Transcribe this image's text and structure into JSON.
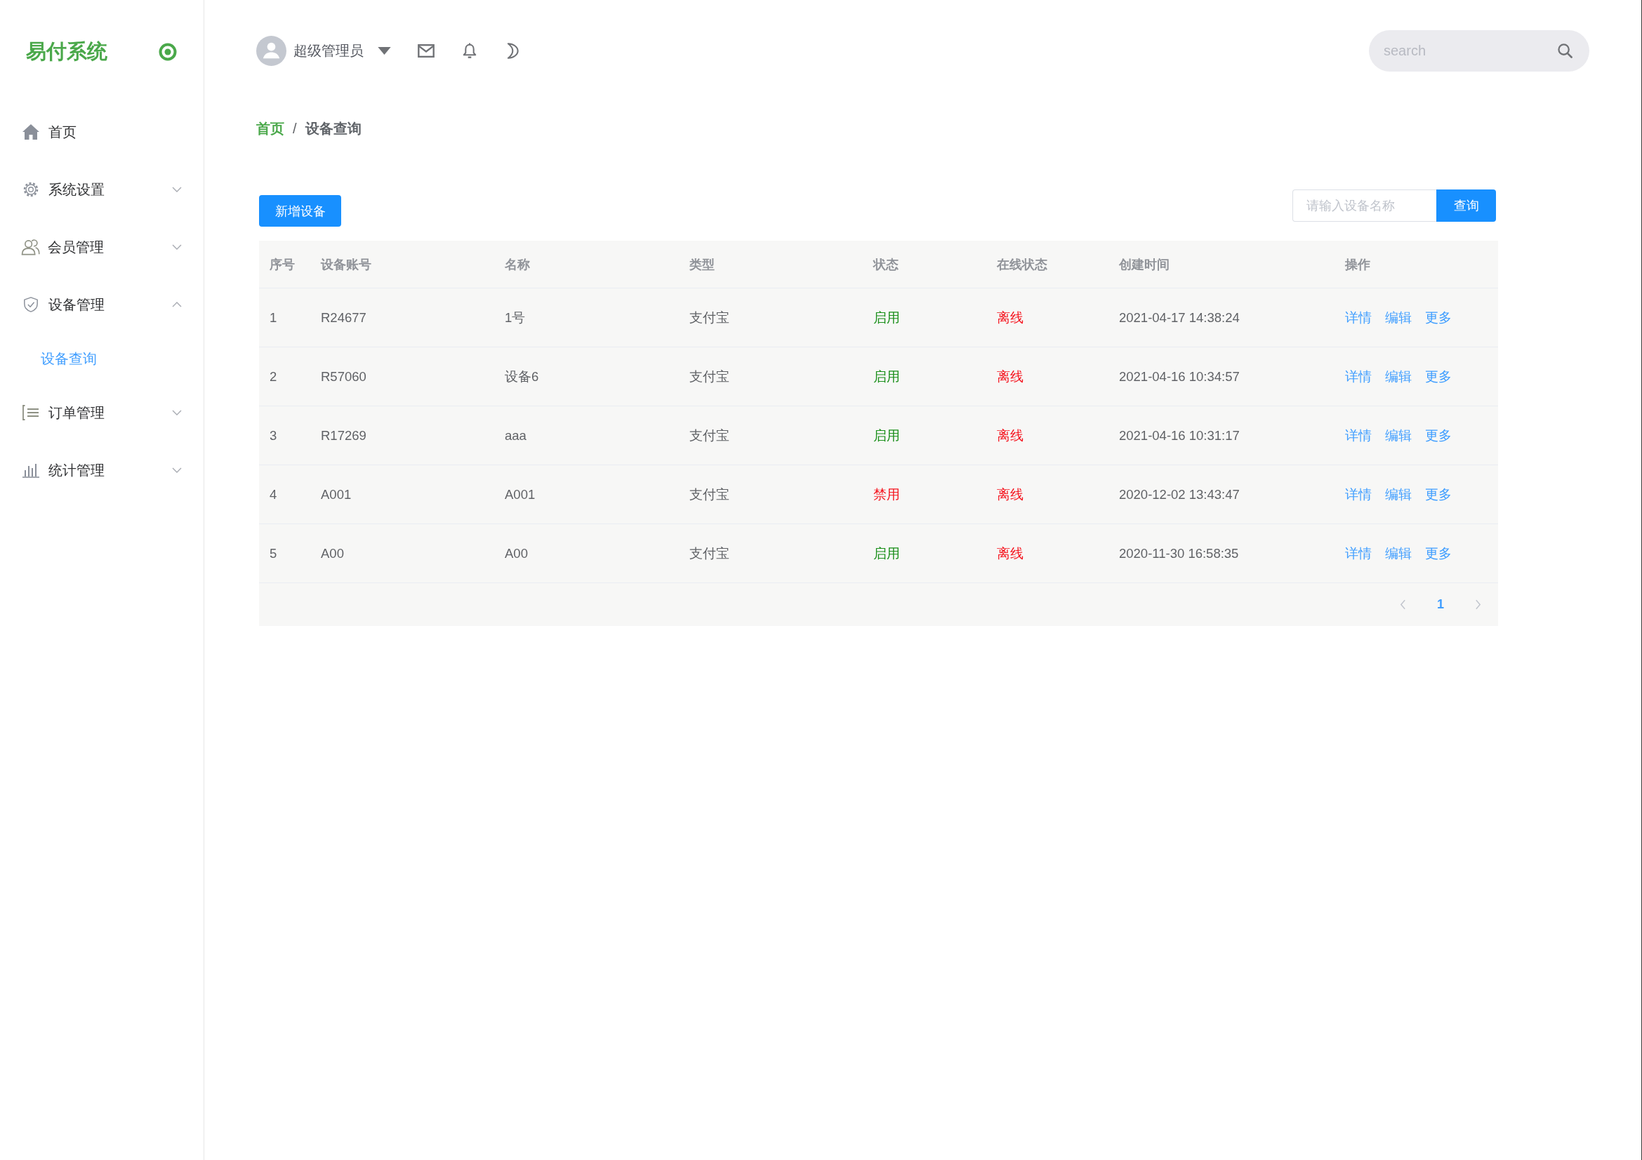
{
  "sidebar": {
    "brand": "易付系统",
    "nav": [
      {
        "label": "首页",
        "kind": "link",
        "selected": false
      },
      {
        "label": "系统设置",
        "kind": "group",
        "expanded": false,
        "selected": false
      },
      {
        "label": "会员管理",
        "kind": "group",
        "expanded": false,
        "selected": false
      },
      {
        "label": "设备管理",
        "kind": "group",
        "expanded": true,
        "selected": false,
        "children": [
          {
            "label": "设备查询",
            "selected": true
          }
        ]
      },
      {
        "label": "订单管理",
        "kind": "group",
        "expanded": false,
        "selected": false
      },
      {
        "label": "统计管理",
        "kind": "group",
        "expanded": false,
        "selected": false
      }
    ]
  },
  "header": {
    "user": {
      "name": "超级管理员"
    },
    "search": {
      "placeholder": "search"
    }
  },
  "breadcrumb": {
    "separator": "/",
    "items": [
      {
        "label": "首页",
        "current": false
      },
      {
        "label": "设备查询",
        "current": true
      }
    ]
  },
  "toolbar": {
    "add_button": "新增设备",
    "filter": {
      "placeholder": "请输入设备名称",
      "button": "查询"
    }
  },
  "table": {
    "columns": [
      "序号",
      "设备账号",
      "名称",
      "类型",
      "状态",
      "在线状态",
      "创建时间",
      "操作"
    ],
    "rows": [
      {
        "index": "1",
        "account": "R24677",
        "name": "1号",
        "type": "支付宝",
        "status": {
          "text": "启用",
          "enabled": true
        },
        "online": {
          "text": "离线",
          "online": false
        },
        "created": "2021-04-17 14:38:24",
        "actions": [
          "详情",
          "编辑",
          "更多"
        ]
      },
      {
        "index": "2",
        "account": "R57060",
        "name": "设备6",
        "type": "支付宝",
        "status": {
          "text": "启用",
          "enabled": true
        },
        "online": {
          "text": "离线",
          "online": false
        },
        "created": "2021-04-16 10:34:57",
        "actions": [
          "详情",
          "编辑",
          "更多"
        ]
      },
      {
        "index": "3",
        "account": "R17269",
        "name": "aaa",
        "type": "支付宝",
        "status": {
          "text": "启用",
          "enabled": true
        },
        "online": {
          "text": "离线",
          "online": false
        },
        "created": "2021-04-16 10:31:17",
        "actions": [
          "详情",
          "编辑",
          "更多"
        ]
      },
      {
        "index": "4",
        "account": "A001",
        "name": "A001",
        "type": "支付宝",
        "status": {
          "text": "禁用",
          "enabled": false
        },
        "online": {
          "text": "离线",
          "online": false
        },
        "created": "2020-12-02 13:43:47",
        "actions": [
          "详情",
          "编辑",
          "更多"
        ]
      },
      {
        "index": "5",
        "account": "A00",
        "name": "A00",
        "type": "支付宝",
        "status": {
          "text": "启用",
          "enabled": true
        },
        "online": {
          "text": "离线",
          "online": false
        },
        "created": "2020-11-30 16:58:35",
        "actions": [
          "详情",
          "编辑",
          "更多"
        ]
      }
    ]
  },
  "pagination": {
    "pages": [
      {
        "label": "1",
        "selected": true
      }
    ]
  }
}
